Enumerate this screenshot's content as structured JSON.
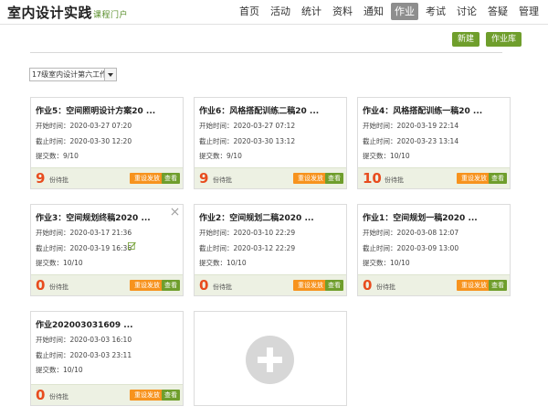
{
  "header": {
    "brand": "室内设计实践",
    "brand_sub": "课程门户",
    "nav": [
      "首页",
      "活动",
      "统计",
      "资料",
      "通知",
      "作业",
      "考试",
      "讨论",
      "答疑",
      "管理"
    ],
    "active_nav": "作业"
  },
  "toolbar": {
    "new_label": "新建",
    "library_label": "作业库"
  },
  "class_select": {
    "value": "17级室内设计第六工作"
  },
  "labels": {
    "start_prefix": "开始时间：",
    "end_prefix": "截止时间：",
    "submit_prefix": "提交数：",
    "pending_suffix": "份待批",
    "reset_label": "重设发放",
    "view_label": "查看"
  },
  "assignments": [
    {
      "title": "作业5：空间照明设计方案20 ...",
      "start": "2020-03-27 07:20",
      "end": "2020-03-30 12:20",
      "submitted": "9/10",
      "pending": "9"
    },
    {
      "title": "作业6：风格搭配训练二稿20 ...",
      "start": "2020-03-27 07:12",
      "end": "2020-03-30 13:12",
      "submitted": "9/10",
      "pending": "9"
    },
    {
      "title": "作业4：风格搭配训练一稿20 ...",
      "start": "2020-03-19 22:14",
      "end": "2020-03-23 13:14",
      "submitted": "10/10",
      "pending": "10"
    },
    {
      "title": "作业3：空间规划终稿2020 ...",
      "start": "2020-03-17 21:36",
      "end": "2020-03-19 16:36",
      "submitted": "10/10",
      "pending": "0"
    },
    {
      "title": "作业2：空间规划二稿2020 ...",
      "start": "2020-03-10 22:29",
      "end": "2020-03-12 22:29",
      "submitted": "10/10",
      "pending": "0"
    },
    {
      "title": "作业1：空间规划一稿2020 ...",
      "start": "2020-03-08 12:07",
      "end": "2020-03-09 13:00",
      "submitted": "10/10",
      "pending": "0"
    },
    {
      "title": "作业202003031609 ...",
      "start": "2020-03-03 16:10",
      "end": "2020-03-03 23:11",
      "submitted": "10/10",
      "pending": "0"
    }
  ],
  "colors": {
    "accent_green": "#6f9e2c",
    "action_orange": "#f7931e",
    "pending_red": "#e84c1e",
    "footer_bg": "#edf1e3"
  },
  "icons": {
    "close": "close-icon",
    "edit": "edit-icon",
    "add": "plus-icon"
  }
}
